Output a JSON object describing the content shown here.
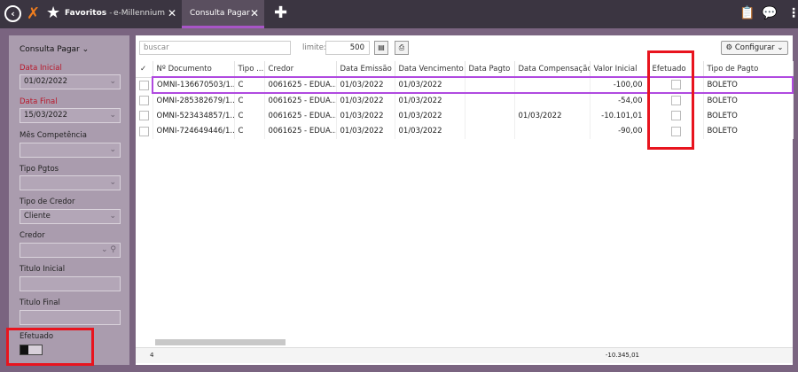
{
  "topbar": {
    "tabs": [
      {
        "label": "Favoritos",
        "separator": "-"
      },
      {
        "label": "e-Millennium"
      },
      {
        "label": "Consulta Pagar"
      }
    ]
  },
  "sidebar": {
    "title": "Consulta Pagar",
    "fields": {
      "data_inicial": {
        "label": "Data Inicial",
        "value": "01/02/2022"
      },
      "data_final": {
        "label": "Data Final",
        "value": "15/03/2022"
      },
      "mes_competencia": {
        "label": "Mês Competência",
        "value": ""
      },
      "tipo_pgtos": {
        "label": "Tipo Pgtos",
        "value": ""
      },
      "tipo_credor": {
        "label": "Tipo de Credor",
        "value": "Cliente"
      },
      "credor": {
        "label": "Credor",
        "value": ""
      },
      "titulo_inicial": {
        "label": "Titulo Inicial",
        "value": ""
      },
      "titulo_final": {
        "label": "Titulo Final",
        "value": ""
      },
      "efetuado": {
        "label": "Efetuado"
      }
    }
  },
  "toolbar": {
    "search_placeholder": "buscar",
    "limite_label": "limite:",
    "limite_value": "500",
    "configurar_label": "Configurar"
  },
  "table": {
    "headers": [
      "Nº Documento",
      "Tipo ...",
      "Credor",
      "Data Emissão",
      "Data Vencimento",
      "Data Pagto",
      "Data Compensação",
      "Valor Inicial",
      "Efetuado",
      "Tipo de Pagto"
    ],
    "rows": [
      [
        "OMNI-136670503/1...",
        "C",
        "0061625 - EDUA...",
        "01/03/2022",
        "01/03/2022",
        "",
        "",
        "-100,00",
        "",
        "BOLETO"
      ],
      [
        "OMNI-285382679/1...",
        "C",
        "0061625 - EDUA...",
        "01/03/2022",
        "01/03/2022",
        "",
        "",
        "-54,00",
        "",
        "BOLETO"
      ],
      [
        "OMNI-523434857/1...",
        "C",
        "0061625 - EDUA...",
        "01/03/2022",
        "01/03/2022",
        "",
        "01/03/2022",
        "-10.101,01",
        "",
        "BOLETO"
      ],
      [
        "OMNI-724649446/1...",
        "C",
        "0061625 - EDUA...",
        "01/03/2022",
        "01/03/2022",
        "",
        "",
        "-90,00",
        "",
        "BOLETO"
      ]
    ]
  },
  "footer": {
    "count": "4",
    "total": "-10.345,01"
  },
  "colors": {
    "accent": "#a855c7",
    "highlight_box": "#e8141e",
    "required_label": "#b8182b"
  }
}
